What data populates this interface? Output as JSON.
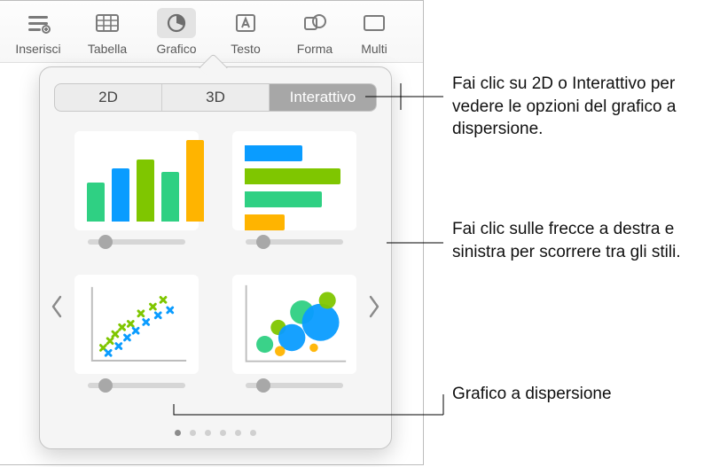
{
  "toolbar": {
    "items": [
      {
        "label": "Inserisci"
      },
      {
        "label": "Tabella"
      },
      {
        "label": "Grafico"
      },
      {
        "label": "Testo"
      },
      {
        "label": "Forma"
      },
      {
        "label": "Multi"
      }
    ]
  },
  "popover": {
    "tabs": {
      "two_d": "2D",
      "three_d": "3D",
      "interactive": "Interattivo"
    }
  },
  "callouts": {
    "tabs": "Fai clic su 2D o Interattivo per vedere le opzioni del grafico a dispersione.",
    "arrows": "Fai clic sulle frecce a destra e sinistra per scorrere tra gli stili.",
    "scatter": "Grafico a dispersione"
  }
}
